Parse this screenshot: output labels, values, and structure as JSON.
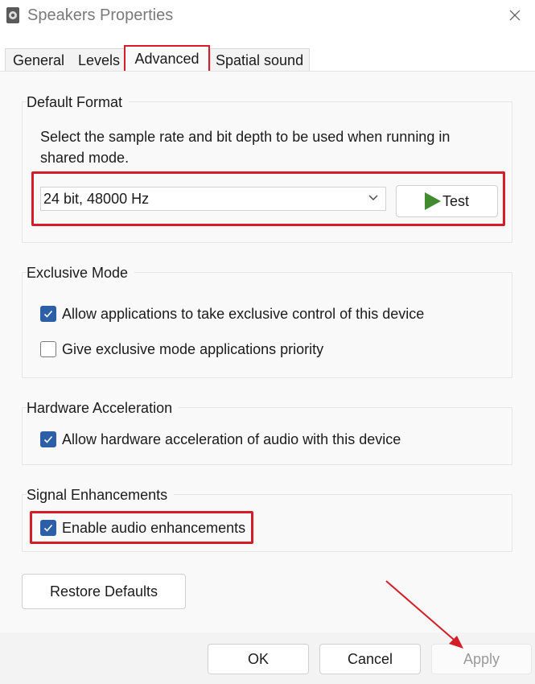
{
  "window": {
    "title": "Speakers Properties"
  },
  "tabs": [
    {
      "label": "General"
    },
    {
      "label": "Levels"
    },
    {
      "label": "Advanced"
    },
    {
      "label": "Spatial sound"
    }
  ],
  "default_format": {
    "title": "Default Format",
    "description": "Select the sample rate and bit depth to be used when running in shared mode.",
    "selected": "24 bit, 48000 Hz",
    "test_label": "Test"
  },
  "exclusive_mode": {
    "title": "Exclusive Mode",
    "allow_exclusive": {
      "label": "Allow applications to take exclusive control of this device",
      "checked": true
    },
    "give_priority": {
      "label": "Give exclusive mode applications priority",
      "checked": false
    }
  },
  "hardware_acceleration": {
    "title": "Hardware Acceleration",
    "allow_hw": {
      "label": "Allow hardware acceleration of audio with this device",
      "checked": true
    }
  },
  "signal_enhancements": {
    "title": "Signal Enhancements",
    "enable": {
      "label": "Enable audio enhancements",
      "checked": true
    }
  },
  "buttons": {
    "restore_defaults": "Restore Defaults",
    "ok": "OK",
    "cancel": "Cancel",
    "apply": "Apply"
  },
  "colors": {
    "highlight": "#d41d26",
    "checkbox_accent": "#2c5fa6",
    "play_icon": "#3f8b2d"
  },
  "icons": {
    "app": "speaker-icon",
    "close": "close-icon",
    "dropdown": "chevron-down-icon",
    "test": "play-icon",
    "check": "checkmark-icon"
  }
}
